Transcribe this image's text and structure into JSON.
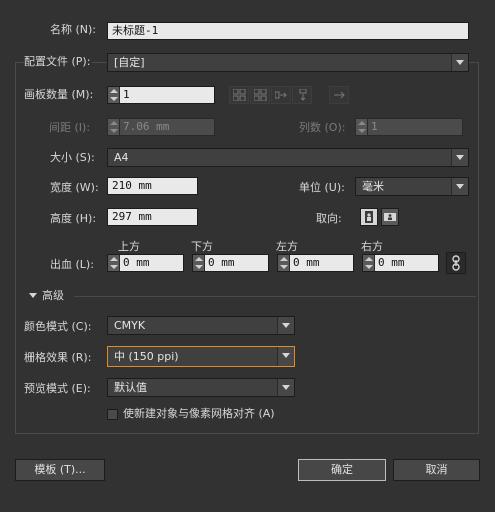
{
  "name": {
    "label": "名称 (N):",
    "value": "未标题-1"
  },
  "profile": {
    "label": "配置文件 (P):",
    "value": "[自定]"
  },
  "artboards": {
    "label": "画板数量 (M):",
    "value": "1"
  },
  "spacing": {
    "label": "间距 (I):",
    "value": "7.06 mm"
  },
  "columns": {
    "label": "列数 (O):",
    "value": "1"
  },
  "size": {
    "label": "大小 (S):",
    "value": "A4"
  },
  "width": {
    "label": "宽度 (W):",
    "value": "210 mm"
  },
  "units": {
    "label": "单位 (U):",
    "value": "毫米"
  },
  "height": {
    "label": "高度 (H):",
    "value": "297 mm"
  },
  "orientation": {
    "label": "取向:"
  },
  "bleed": {
    "label": "出血 (L):",
    "top": {
      "label": "上方",
      "value": "0 mm"
    },
    "bottom": {
      "label": "下方",
      "value": "0 mm"
    },
    "left": {
      "label": "左方",
      "value": "0 mm"
    },
    "right": {
      "label": "右方",
      "value": "0 mm"
    }
  },
  "advanced": {
    "label": "高级"
  },
  "color_mode": {
    "label": "颜色模式 (C):",
    "value": "CMYK"
  },
  "raster": {
    "label": "栅格效果 (R):",
    "value": "中 (150 ppi)"
  },
  "preview": {
    "label": "预览模式 (E):",
    "value": "默认值"
  },
  "align_pixel": {
    "label": "使新建对象与像素网格对齐 (A)",
    "checked": false
  },
  "buttons": {
    "templates": "模板 (T)...",
    "ok": "确定",
    "cancel": "取消"
  },
  "colors": {
    "background": "#323232",
    "highlight": "#e08a2a"
  }
}
